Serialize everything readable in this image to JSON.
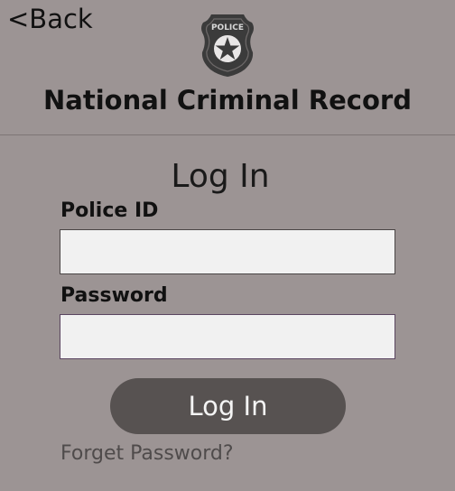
{
  "header": {
    "back_label": "<Back",
    "badge_icon": "police-badge-icon",
    "badge_text": "POLICE",
    "app_title": "National Criminal Record"
  },
  "form": {
    "title": "Log In",
    "police_id": {
      "label": "Police ID",
      "value": "",
      "placeholder": ""
    },
    "password": {
      "label": "Password",
      "value": "",
      "placeholder": ""
    },
    "submit_label": "Log In",
    "forgot_label": "Forget Password?"
  },
  "colors": {
    "background": "#9c9494",
    "button": "#575251",
    "input_background": "#f1f1f1",
    "badge": "#3b3b3b"
  }
}
